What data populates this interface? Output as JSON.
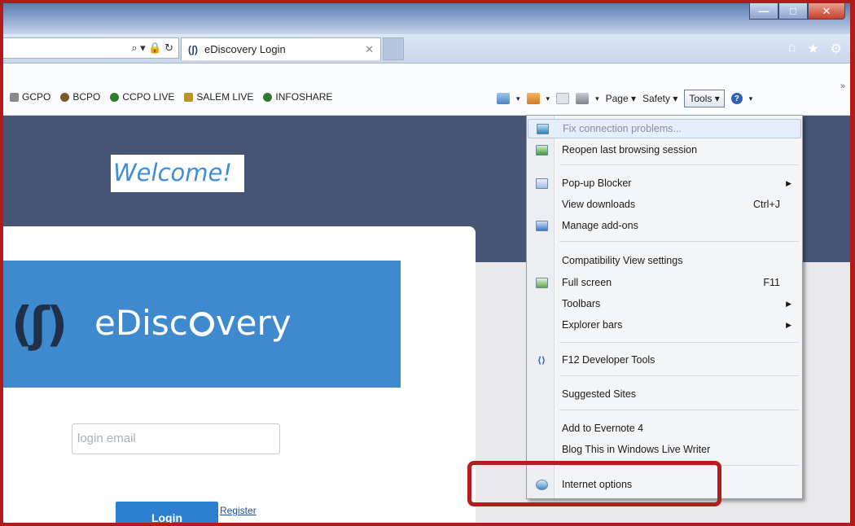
{
  "window": {
    "minimize_glyph": "—",
    "maximize_glyph": "□",
    "close_glyph": "✕"
  },
  "address_bar": {
    "icons": [
      "search-icon",
      "dropdown-icon",
      "lock-icon",
      "refresh-icon"
    ],
    "glyphs": "⌕ ▾ 🔒 ↻"
  },
  "tab": {
    "favicon_text": "(ʃ)",
    "title": "eDiscovery Login",
    "close": "✕"
  },
  "nav_icons": {
    "home": "⌂",
    "favorites": "★",
    "settings": "⚙"
  },
  "favorites_bar": [
    {
      "label": "GCPO",
      "color": "#8a8a8a"
    },
    {
      "label": "BCPO",
      "color": "#7a5a2c"
    },
    {
      "label": "CCPO LIVE",
      "color": "#2e7d2e"
    },
    {
      "label": "SALEM LIVE",
      "color": "#b8962a"
    },
    {
      "label": "INFOSHARE",
      "color": "#2e7d2e"
    }
  ],
  "command_bar": {
    "page_label": "Page ▾",
    "safety_label": "Safety ▾",
    "tools_label": "Tools ▾",
    "help_label": "?",
    "chevron": "»"
  },
  "page": {
    "welcome": "Welcome!",
    "logo_mark": "(ʃ)",
    "logo_text_prefix": "eDisc",
    "logo_text_suffix": "very",
    "login_placeholder": "login email",
    "login_button": "Login",
    "register_link": "Register"
  },
  "tools_menu": {
    "items": [
      {
        "label": "Fix connection problems...",
        "shortcut": "",
        "submenu": false,
        "disabled": true
      },
      {
        "label": "Reopen last browsing session",
        "shortcut": "",
        "submenu": false,
        "disabled": false
      },
      {
        "label": "Pop-up Blocker",
        "shortcut": "",
        "submenu": true,
        "disabled": false
      },
      {
        "label": "View downloads",
        "shortcut": "Ctrl+J",
        "submenu": false,
        "disabled": false
      },
      {
        "label": "Manage add-ons",
        "shortcut": "",
        "submenu": false,
        "disabled": false
      },
      {
        "label": "Compatibility View settings",
        "shortcut": "",
        "submenu": false,
        "disabled": false
      },
      {
        "label": "Full screen",
        "shortcut": "F11",
        "submenu": false,
        "disabled": false
      },
      {
        "label": "Toolbars",
        "shortcut": "",
        "submenu": true,
        "disabled": false
      },
      {
        "label": "Explorer bars",
        "shortcut": "",
        "submenu": true,
        "disabled": false
      },
      {
        "label": "F12 Developer Tools",
        "shortcut": "",
        "submenu": false,
        "disabled": false
      },
      {
        "label": "Suggested Sites",
        "shortcut": "",
        "submenu": false,
        "disabled": false
      },
      {
        "label": "Add to Evernote 4",
        "shortcut": "",
        "submenu": false,
        "disabled": false
      },
      {
        "label": "Blog This in Windows Live Writer",
        "shortcut": "",
        "submenu": false,
        "disabled": false
      },
      {
        "label": "Internet options",
        "shortcut": "",
        "submenu": false,
        "disabled": false
      }
    ],
    "submenu_arrow": "▶"
  },
  "colors": {
    "frame_red": "#b21b1b",
    "banner": "#465575",
    "logo_blue": "#3f89cf",
    "login_blue": "#2c7fd0",
    "welcome_blue": "#3d8fd6"
  }
}
